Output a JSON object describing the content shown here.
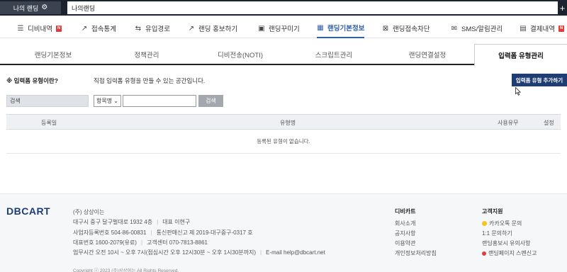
{
  "topbar": {
    "my_page_label": "나의 랜딩",
    "current_tab_label": "나의랜딩",
    "add_tab_symbol": "+"
  },
  "nav": {
    "items": [
      {
        "label": "디비내역",
        "icon": "list-icon",
        "badge": "N"
      },
      {
        "label": "접속통계",
        "icon": "chart-icon"
      },
      {
        "label": "유입경로",
        "icon": "route-icon"
      },
      {
        "label": "랜딩 홍보하기",
        "icon": "share-icon"
      },
      {
        "label": "랜딩꾸미기",
        "icon": "design-icon"
      },
      {
        "label": "랜딩기본정보",
        "icon": "grid-icon"
      },
      {
        "label": "랜딩접속차단",
        "icon": "block-icon"
      },
      {
        "label": "SMS/알림관리",
        "icon": "mail-icon"
      },
      {
        "label": "결제내역",
        "icon": "receipt-icon",
        "badge": "N"
      }
    ],
    "active_index": 5
  },
  "subtabs": {
    "items": [
      "랜딩기본정보",
      "정책관리",
      "디비전송(NOTI)",
      "스크립트관리",
      "랜딩연결설정",
      "입력폼 유형관리"
    ],
    "active_index": 5
  },
  "info": {
    "question": "※ 입력폼 유형이란?",
    "description": "직접 입력폼 유형을 만들 수 있는 공간입니다.",
    "add_button": "입력폼 유형 추가하기"
  },
  "search": {
    "label": "검색",
    "select_value": "항목명",
    "input_value": "",
    "button": "검색"
  },
  "table": {
    "headers": [
      "등록일",
      "유형명",
      "사용유무",
      "설정"
    ],
    "empty_message": "등록된 유형이 없습니다."
  },
  "footer": {
    "logo": "DBCART",
    "company_name": "(주) 상상이는",
    "address": "대구시 중구 달구벌대로 1932 4층",
    "ceo": "대표 이현구",
    "business_no": "사업자등록번호 504-86-00831",
    "mail_order_no": "통신판매신고 제 2019-대구중구-0317 호",
    "phone": "대표번호 1600-2079(유료)",
    "center": "고객센터 070-7813-8861",
    "hours": "업무시간 오전 10시 ~ 오후 7시(점심시간 오후 12시30분 ~ 오후 1시30분까지)",
    "email": "E-mail help@dbcart.net",
    "copyright": "Copyright ⓒ 2023 (주)상상이는 All Rights Reserved.",
    "dbcart_col": {
      "title": "디비카트",
      "items": [
        "회사소개",
        "공지사항",
        "이용약관",
        "개인정보처리방침"
      ]
    },
    "support_col": {
      "title": "고객지원",
      "items": [
        "카카오톡 문의",
        "1:1 문의하기",
        "랜딩홍보시 유의사항",
        "랜딩페이지 스펜신고"
      ]
    }
  }
}
